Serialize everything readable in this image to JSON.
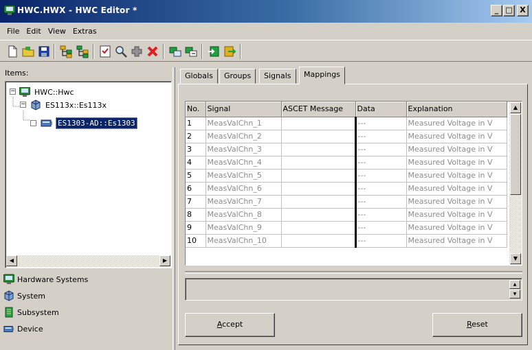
{
  "window": {
    "title": "HWC.HWX - HWC Editor  *",
    "min_label": "_",
    "max_label": "□",
    "close_label": "X"
  },
  "menu": [
    "File",
    "Edit",
    "View",
    "Extras"
  ],
  "toolbar_icons": [
    "new-file-icon",
    "open-file-icon",
    "save-icon",
    "hierarchy-icon",
    "hierarchy-2-icon",
    "checklist-icon",
    "search-tool-icon",
    "add-icon",
    "delete-icon",
    "connect-icon",
    "configure-icon",
    "import-icon",
    "export-icon"
  ],
  "left": {
    "items_label": "Items:",
    "tree": [
      {
        "label": "HWC::Hwc",
        "icon": "hardware-system-icon",
        "expander": "−"
      },
      {
        "label": "ES113x::Es113x",
        "icon": "system-icon",
        "expander": "−"
      },
      {
        "label": "ES1303-AD::Es1303",
        "icon": "device-icon",
        "expander": "",
        "selected": true
      }
    ],
    "legend": [
      {
        "label": "Hardware Systems",
        "icon": "hardware-system-icon"
      },
      {
        "label": "System",
        "icon": "system-icon"
      },
      {
        "label": "Subsystem",
        "icon": "subsystem-icon"
      },
      {
        "label": "Device",
        "icon": "device-icon"
      }
    ]
  },
  "tabs": [
    "Globals",
    "Groups",
    "Signals",
    "Mappings"
  ],
  "active_tab": "Mappings",
  "grid": {
    "columns": [
      "No.",
      "Signal",
      "ASCET Message",
      "Data",
      "Explanation"
    ],
    "rows": [
      {
        "no": "1",
        "signal": "MeasValChn_1",
        "message": "",
        "data": "---",
        "explanation": "Measured Voltage in V"
      },
      {
        "no": "2",
        "signal": "MeasValChn_2",
        "message": "",
        "data": "---",
        "explanation": "Measured Voltage in V"
      },
      {
        "no": "3",
        "signal": "MeasValChn_3",
        "message": "",
        "data": "---",
        "explanation": "Measured Voltage in V"
      },
      {
        "no": "4",
        "signal": "MeasValChn_4",
        "message": "",
        "data": "---",
        "explanation": "Measured Voltage in V"
      },
      {
        "no": "5",
        "signal": "MeasValChn_5",
        "message": "",
        "data": "---",
        "explanation": "Measured Voltage in V"
      },
      {
        "no": "6",
        "signal": "MeasValChn_6",
        "message": "",
        "data": "---",
        "explanation": "Measured Voltage in V"
      },
      {
        "no": "7",
        "signal": "MeasValChn_7",
        "message": "",
        "data": "---",
        "explanation": "Measured Voltage in V"
      },
      {
        "no": "8",
        "signal": "MeasValChn_8",
        "message": "",
        "data": "---",
        "explanation": "Measured Voltage in V"
      },
      {
        "no": "9",
        "signal": "MeasValChn_9",
        "message": "",
        "data": "---",
        "explanation": "Measured Voltage in V"
      },
      {
        "no": "10",
        "signal": "MeasValChn_10",
        "message": "",
        "data": "---",
        "explanation": "Measured Voltage in V"
      }
    ]
  },
  "buttons": {
    "accept_hotkey": "A",
    "accept_rest": "ccept",
    "reset_hotkey": "R",
    "reset_rest": "eset"
  },
  "colors": {
    "selection": "#0a246a",
    "titlebar_start": "#0a246a",
    "titlebar_end": "#a6caf0"
  }
}
